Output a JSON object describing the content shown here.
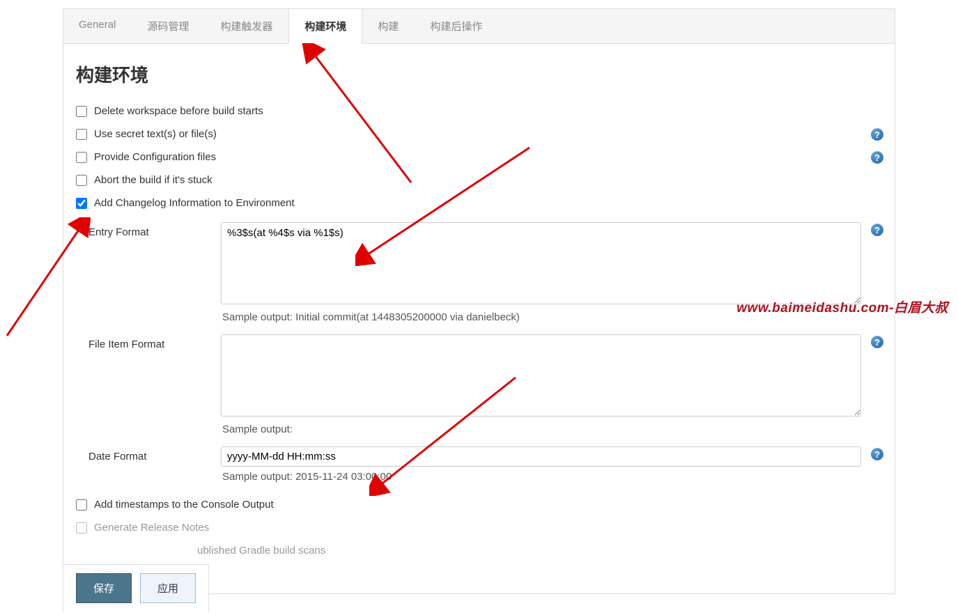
{
  "tabs": [
    {
      "label": "General"
    },
    {
      "label": "源码管理"
    },
    {
      "label": "构建触发器"
    },
    {
      "label": "构建环境"
    },
    {
      "label": "构建"
    },
    {
      "label": "构建后操作"
    }
  ],
  "active_tab_index": 3,
  "section_title": "构建环境",
  "options": {
    "delete_workspace": {
      "label": "Delete workspace before build starts",
      "checked": false
    },
    "use_secret": {
      "label": "Use secret text(s) or file(s)",
      "checked": false,
      "help": true
    },
    "provide_config": {
      "label": "Provide Configuration files",
      "checked": false,
      "help": true
    },
    "abort_stuck": {
      "label": "Abort the build if it's stuck",
      "checked": false
    },
    "add_changelog": {
      "label": "Add Changelog Information to Environment",
      "checked": true
    },
    "add_timestamps": {
      "label": "Add timestamps to the Console Output",
      "checked": false
    },
    "generate_release": {
      "label": "Generate Release Notes",
      "checked": false
    },
    "gradle_scans": {
      "label": "ublished Gradle build scans",
      "partial_prefix": "",
      "checked": false
    },
    "with_ant": {
      "label": "With Ant",
      "checked": false
    }
  },
  "changelog_fields": {
    "entry_format": {
      "label": "Entry Format",
      "value": "%3$s(at %4$s via %1$s)",
      "sample": "Sample output: Initial commit(at 1448305200000 via danielbeck)",
      "help": true
    },
    "file_item_format": {
      "label": "File Item Format",
      "value": "",
      "sample": "Sample output:",
      "help": true
    },
    "date_format": {
      "label": "Date Format",
      "value": "yyyy-MM-dd HH:mm:ss",
      "sample": "Sample output: 2015-11-24 03:00:00",
      "help": true
    }
  },
  "buttons": {
    "save": "保存",
    "apply": "应用"
  },
  "watermark": "www.baimeidashu.com-白眉大叔",
  "help_glyph": "?"
}
